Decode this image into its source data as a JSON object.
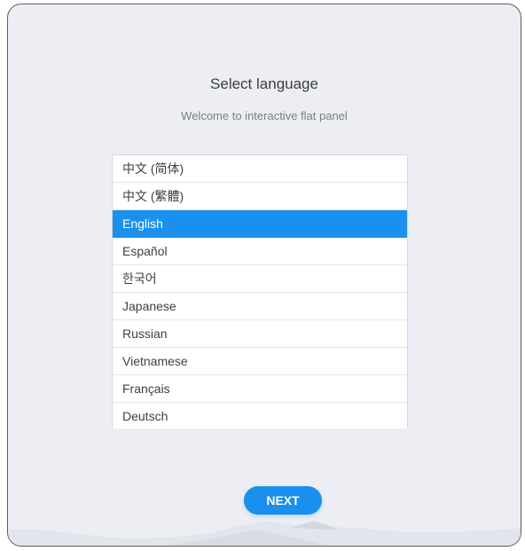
{
  "header": {
    "title": "Select language",
    "subtitle": "Welcome to interactive flat panel"
  },
  "languages": [
    {
      "label": "中文 (简体)",
      "selected": false
    },
    {
      "label": "中文 (繁體)",
      "selected": false
    },
    {
      "label": "English",
      "selected": true
    },
    {
      "label": "Español",
      "selected": false
    },
    {
      "label": "한국어",
      "selected": false
    },
    {
      "label": "Japanese",
      "selected": false
    },
    {
      "label": "Russian",
      "selected": false
    },
    {
      "label": "Vietnamese",
      "selected": false
    },
    {
      "label": "Français",
      "selected": false
    },
    {
      "label": "Deutsch",
      "selected": false
    }
  ],
  "footer": {
    "next_label": "NEXT"
  },
  "colors": {
    "accent": "#1a91ee",
    "background": "#eceef3",
    "list_background": "#ffffff"
  }
}
